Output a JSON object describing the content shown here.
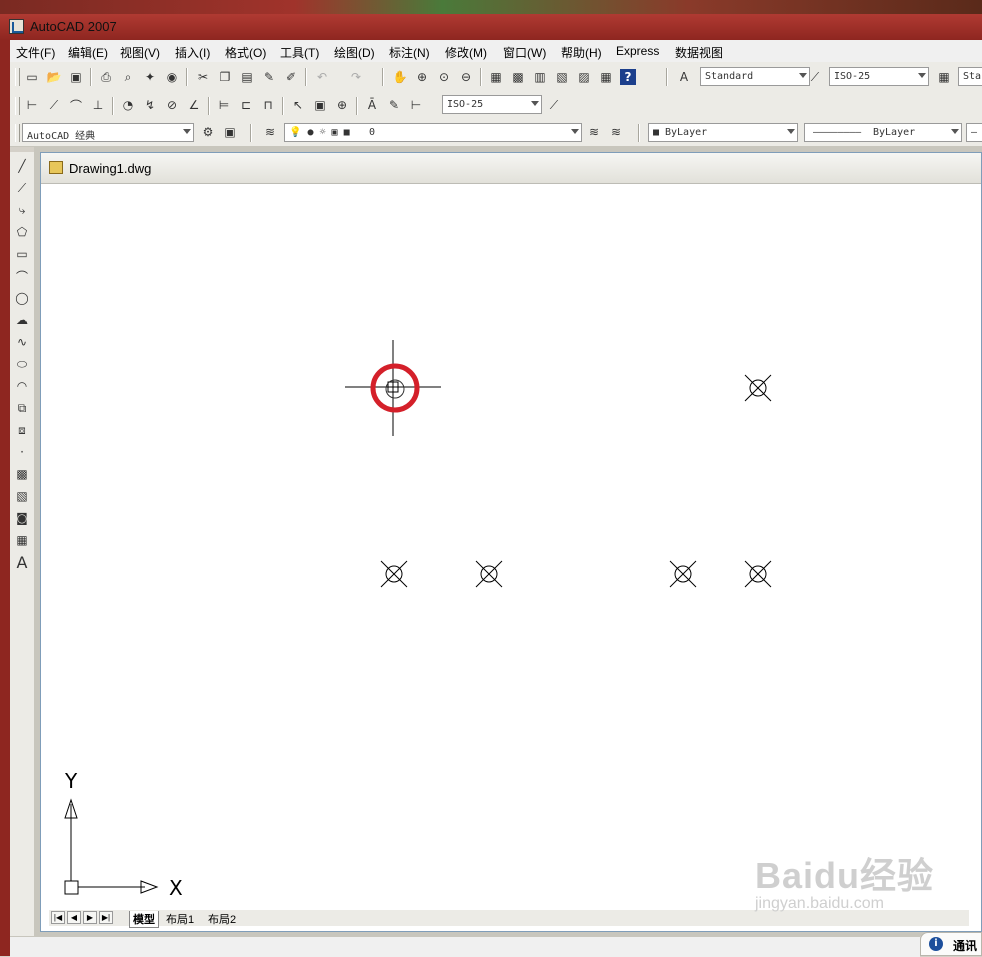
{
  "window": {
    "title": "AutoCAD 2007"
  },
  "menu": [
    "文件(F)",
    "编辑(E)",
    "视图(V)",
    "插入(I)",
    "格式(O)",
    "工具(T)",
    "绘图(D)",
    "标注(N)",
    "修改(M)",
    "窗口(W)",
    "帮助(H)",
    "Express",
    "数据视图"
  ],
  "toolbars": {
    "text_style": "Standard",
    "dim_style": "ISO-25",
    "table_style_partial": "Sta",
    "dim_style_2": "ISO-25",
    "workspace": "AutoCAD 经典",
    "layer": "0",
    "color": "ByLayer",
    "linetype": "ByLayer"
  },
  "document": {
    "title": "Drawing1.dwg",
    "tabs": [
      "模型",
      "布局1",
      "布局2"
    ],
    "ucs": {
      "x_label": "X",
      "y_label": "Y"
    },
    "highlight_color": "#d4202a"
  },
  "status": {
    "comm_label": "通讯"
  },
  "watermark": {
    "brand": "Baidu经验",
    "url": "jingyan.baidu.com"
  },
  "icons": {
    "draw_toolbar": [
      "line-icon",
      "construction-line-icon",
      "polyline-icon",
      "polygon-icon",
      "rectangle-icon",
      "arc-icon",
      "circle-icon",
      "revision-cloud-icon",
      "spline-icon",
      "ellipse-icon",
      "ellipse-arc-icon",
      "insert-block-icon",
      "make-block-icon",
      "point-icon",
      "hatch-icon",
      "gradient-icon",
      "region-icon",
      "table-icon",
      "multiline-text-icon"
    ]
  }
}
